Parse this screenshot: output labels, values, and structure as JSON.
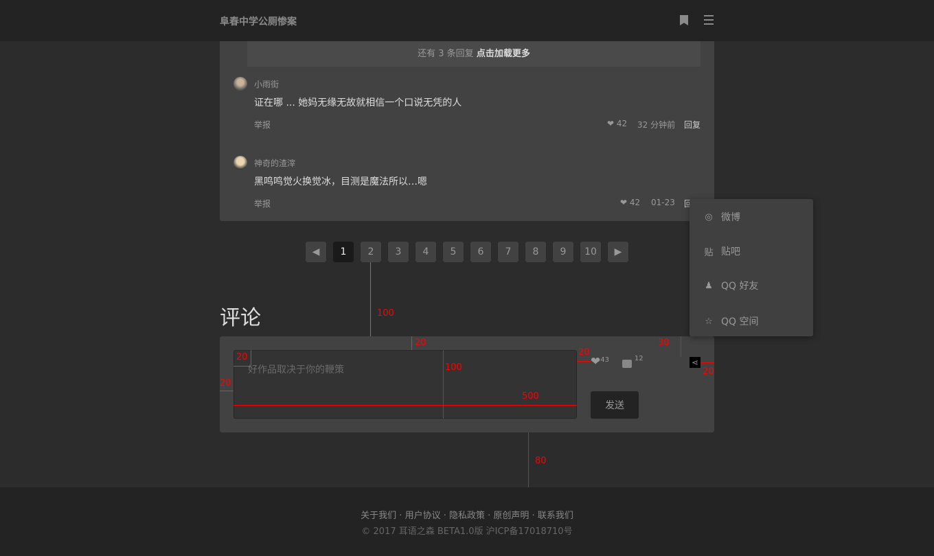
{
  "header": {
    "title": "阜春中学公厕惨案",
    "icons": [
      "bookmark-icon",
      "menu-icon"
    ]
  },
  "comments": {
    "load_more": {
      "prefix": "还有 3 条回复",
      "action": "点击加载更多"
    },
    "items": [
      {
        "name": "小雨街",
        "text": "证在哪 ... 她妈无缘无故就相信一个口说无凭的人",
        "report": "举报",
        "likes": "42",
        "time": "32 分钟前",
        "reply": "回复"
      },
      {
        "name": "神奇的渣滓",
        "text": "黑鸣鸣觉火换觉冰，目测是魔法所以…嗯",
        "report": "举报",
        "likes": "42",
        "time": "01-23",
        "reply": "回复"
      }
    ]
  },
  "pagination": {
    "pages": [
      "1",
      "2",
      "3",
      "4",
      "5",
      "6",
      "7",
      "8",
      "9",
      "10"
    ],
    "current": "1"
  },
  "comment_form": {
    "title": "评论",
    "placeholder": "好作品取决于你的鞭策",
    "send": "发送",
    "likes": "43",
    "comments": "12"
  },
  "share_menu": [
    {
      "icon": "weibo-icon",
      "glyph": "◎",
      "label": "微博"
    },
    {
      "icon": "tieba-icon",
      "glyph": "贴",
      "label": "贴吧"
    },
    {
      "icon": "qq-icon",
      "glyph": "♟",
      "label": "QQ 好友"
    },
    {
      "icon": "qzone-icon",
      "glyph": "☆",
      "label": "QQ 空间"
    }
  ],
  "annotations": [
    "100",
    "20",
    "30",
    "20",
    "20",
    "100",
    "500",
    "20",
    "20",
    "80"
  ],
  "footer": {
    "links": [
      "关于我们",
      "用户协议",
      "隐私政策",
      "原创声明",
      "联系我们"
    ],
    "copyright": "© 2017  耳语之森  BETA1.0版  沪ICP备17018710号"
  },
  "colors": {
    "background": "#2c2c2c",
    "header": "#232323",
    "card": "#424242",
    "annotation": "#ff0000"
  }
}
